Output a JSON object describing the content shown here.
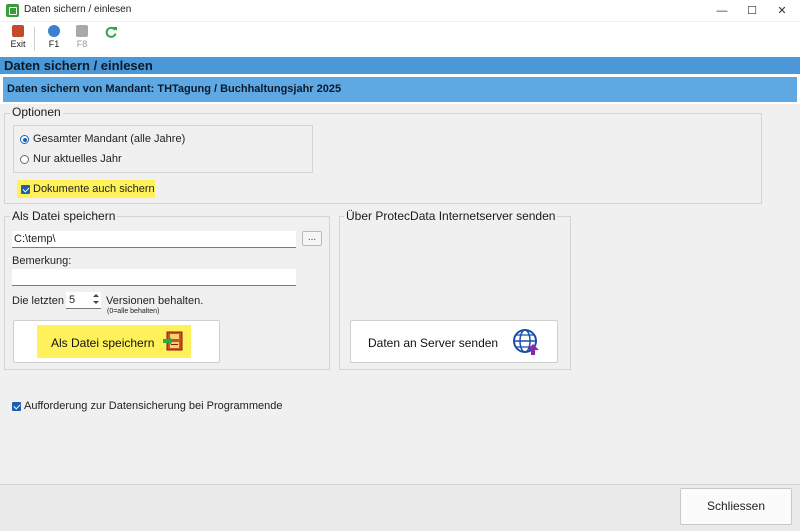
{
  "window": {
    "title": "Daten sichern / einlesen",
    "controls": {
      "minimize": "—",
      "maximize": "☐",
      "close": "✕"
    }
  },
  "toolbar": {
    "exit_label": "Exit",
    "f1_label": "F1",
    "f8_label": "F8"
  },
  "header": {
    "section_title": "Daten sichern / einlesen",
    "mandant_text": "Daten sichern von Mandant: THTagung / Buchhaltungsjahr 2025"
  },
  "options": {
    "title": "Optionen",
    "radio_all": "Gesamter Mandant (alle Jahre)",
    "radio_current": "Nur aktuelles Jahr",
    "documents_label": "Dokumente auch sichern"
  },
  "file_save": {
    "title": "Als Datei speichern",
    "path_value": "C:\\temp\\",
    "browse_label": "...",
    "remark_label": "Bemerkung:",
    "remark_value": "",
    "keep_prefix": "Die letzten",
    "keep_value": "5",
    "keep_suffix": "Versionen behalten.",
    "keep_hint": "(0=alle behalten)",
    "save_button_label": "Als Datei speichern"
  },
  "server": {
    "title": "Über ProtecData Internetserver senden",
    "send_button_label": "Daten an Server senden"
  },
  "reminder_label": "Aufforderung zur Datensicherung bei Programmende",
  "footer": {
    "close_label": "Schliessen"
  },
  "colors": {
    "header_blue": "#4a98d8",
    "mandant_blue": "#5ea8e4",
    "highlight_yellow": "#fff15a",
    "checkbox_blue": "#1a5fb4"
  }
}
